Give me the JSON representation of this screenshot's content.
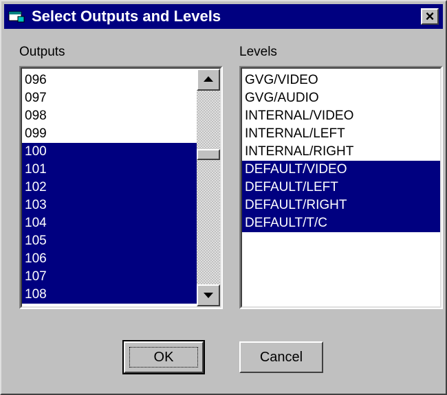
{
  "window": {
    "title": "Select Outputs and Levels",
    "close_glyph": "×",
    "icon": "application-icon"
  },
  "outputs": {
    "label": "Outputs",
    "items": [
      {
        "text": "096",
        "selected": false
      },
      {
        "text": "097",
        "selected": false
      },
      {
        "text": "098",
        "selected": false
      },
      {
        "text": "099",
        "selected": false
      },
      {
        "text": "100",
        "selected": true
      },
      {
        "text": "101",
        "selected": true
      },
      {
        "text": "102",
        "selected": true
      },
      {
        "text": "103",
        "selected": true
      },
      {
        "text": "104",
        "selected": true
      },
      {
        "text": "105",
        "selected": true
      },
      {
        "text": "106",
        "selected": true
      },
      {
        "text": "107",
        "selected": true
      },
      {
        "text": "108",
        "selected": true
      }
    ]
  },
  "levels": {
    "label": "Levels",
    "items": [
      {
        "text": "GVG/VIDEO",
        "selected": false
      },
      {
        "text": "GVG/AUDIO",
        "selected": false
      },
      {
        "text": "INTERNAL/VIDEO",
        "selected": false
      },
      {
        "text": "INTERNAL/LEFT",
        "selected": false
      },
      {
        "text": "INTERNAL/RIGHT",
        "selected": false
      },
      {
        "text": "DEFAULT/VIDEO",
        "selected": true
      },
      {
        "text": "DEFAULT/LEFT",
        "selected": true
      },
      {
        "text": "DEFAULT/RIGHT",
        "selected": true
      },
      {
        "text": "DEFAULT/T/C",
        "selected": true
      }
    ]
  },
  "buttons": {
    "ok": "OK",
    "cancel": "Cancel"
  },
  "colors": {
    "title_bar": "#000080",
    "selection": "#000080",
    "face": "#c0c0c0"
  }
}
